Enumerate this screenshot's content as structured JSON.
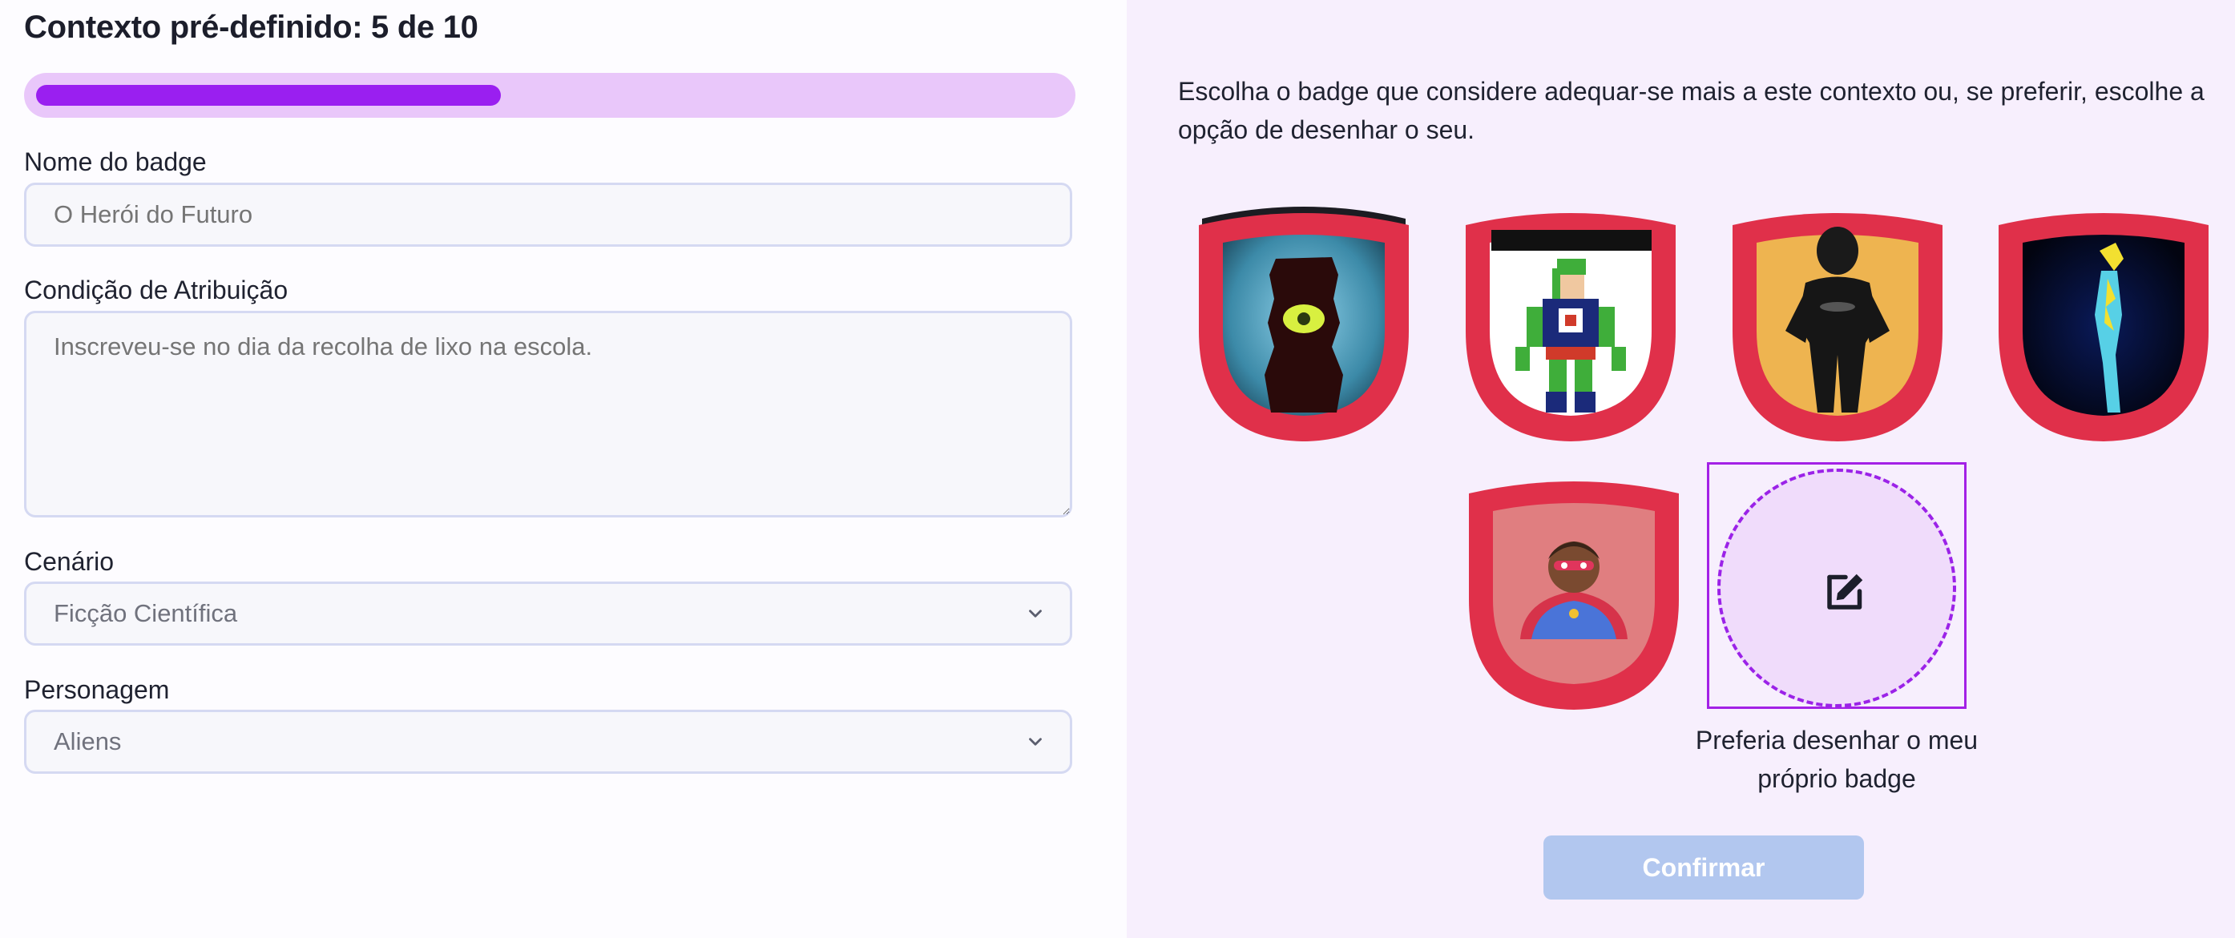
{
  "header": {
    "title": "Contexto pré-definido: 5 de 10",
    "progress_fraction": 0.5
  },
  "form": {
    "badge_name": {
      "label": "Nome do badge",
      "placeholder": "O Herói do Futuro"
    },
    "condition": {
      "label": "Condição de Atribuição",
      "placeholder": "Inscreveu-se no dia da recolha de lixo na escola."
    },
    "scenario": {
      "label": "Cenário",
      "value": "Ficção Científica"
    },
    "character": {
      "label": "Personagem",
      "value": "Aliens"
    }
  },
  "selector": {
    "instructions": "Escolha o badge que considere adequar-se mais a este contexto ou, se preferir, escolhe a opção de desenhar o seu.",
    "badges": [
      {
        "name": "cyclops-tower-badge"
      },
      {
        "name": "pixel-hero-badge"
      },
      {
        "name": "black-suit-hero-badge"
      },
      {
        "name": "lightning-hero-badge"
      },
      {
        "name": "caped-hero-badge"
      }
    ],
    "draw_option": {
      "caption": "Preferia desenhar o meu próprio badge",
      "icon": "edit-icon"
    },
    "confirm_label": "Confirmar"
  },
  "colors": {
    "accent": "#9a1ff0",
    "progress_track": "#e9c7fa",
    "shield_red": "#e0304a",
    "right_panel_bg": "#f7effd",
    "confirm_disabled": "#b2c7ef"
  }
}
